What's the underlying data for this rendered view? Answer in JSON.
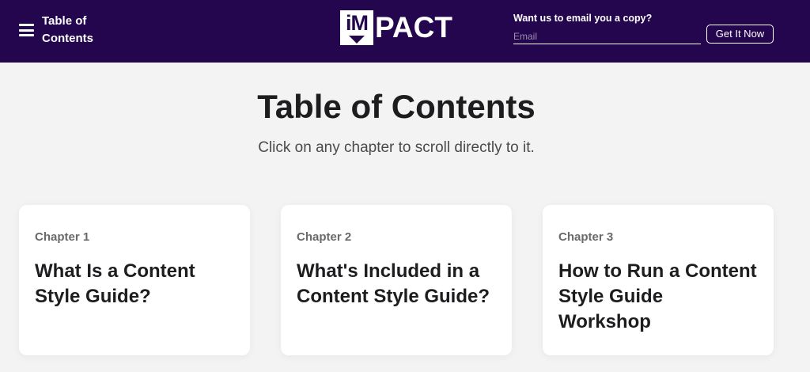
{
  "header": {
    "menu_label": "Table of Contents",
    "logo_mark": "iM",
    "logo_rest": "PACT",
    "email_prompt": "Want us to email you a copy?",
    "email_placeholder": "Email",
    "email_value": "",
    "cta_label": "Get It Now",
    "icons": [
      "hamburger-menu-icon"
    ],
    "colors": {
      "bar_bg": "#24064f",
      "page_bg": "#f3f3f3"
    }
  },
  "main": {
    "title": "Table of Contents",
    "subtitle": "Click on any chapter to scroll directly to it.",
    "chapters": [
      {
        "label": "Chapter 1",
        "title": "What Is a Content Style Guide?"
      },
      {
        "label": "Chapter 2",
        "title": "What's Included in a Content Style Guide?"
      },
      {
        "label": "Chapter 3",
        "title": "How to Run a Content Style Guide Workshop"
      }
    ]
  }
}
